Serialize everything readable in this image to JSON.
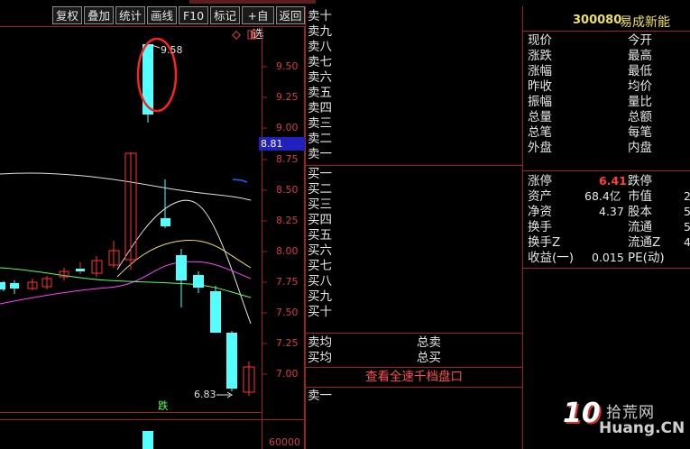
{
  "toolbar": {
    "buttons": [
      "复权",
      "叠加",
      "统计",
      "画线",
      "F10",
      "标记",
      "+自选",
      "返回"
    ]
  },
  "chart": {
    "price_ticks": [
      "9.50",
      "9.25",
      "9.00",
      "8.75",
      "8.50",
      "8.25",
      "8.00",
      "7.75",
      "7.50",
      "7.25",
      "7.00"
    ],
    "current_price_tag": "8.81",
    "high_annotation": "9.58",
    "low_annotation": "6.83",
    "volume_tick": "60000",
    "limit_down_marker": "跌"
  },
  "stock": {
    "code": "300080",
    "name": "易成新能"
  },
  "order_book": {
    "sell_levels": [
      "卖十",
      "卖九",
      "卖八",
      "卖七",
      "卖六",
      "卖五",
      "卖四",
      "卖三",
      "卖二",
      "卖一"
    ],
    "buy_levels": [
      "买一",
      "买二",
      "买三",
      "买四",
      "买五",
      "买六",
      "买七",
      "买八",
      "买九",
      "买十"
    ],
    "sell_avg_label": "卖均",
    "buy_avg_label": "买均",
    "total_sell_label": "总卖",
    "total_buy_label": "总买",
    "full_depth_link": "查看全速千档盘口",
    "bottom_sell_label": "卖一"
  },
  "quote": {
    "rows": [
      {
        "l": "现价",
        "r": "今开"
      },
      {
        "l": "涨跌",
        "r": "最高"
      },
      {
        "l": "涨幅",
        "r": "最低"
      },
      {
        "l": "昨收",
        "r": "均价"
      },
      {
        "l": "振幅",
        "r": "量比"
      },
      {
        "l": "总量",
        "r": "总额"
      },
      {
        "l": "总笔",
        "r": "每笔"
      },
      {
        "l": "外盘",
        "r": "内盘"
      }
    ],
    "limit_up_label": "涨停",
    "limit_up_value": "6.41",
    "limit_down_label": "跌停",
    "assets_label": "资产",
    "assets_value": "68.4亿",
    "market_value_label": "市值",
    "market_value_partial": "2",
    "net_assets_label": "净资",
    "net_assets_value": "4.37",
    "share_capital_label": "股本",
    "share_capital_partial": "5",
    "turnover_label": "换手",
    "float_label": "流通",
    "float_partial": "5",
    "turnover_z_label": "换手Z",
    "float_z_label": "流通Z",
    "float_z_partial": "4",
    "eps_label": "收益(一)",
    "eps_value": "0.015",
    "pe_label": "PE(动)"
  },
  "watermark": {
    "text1": "拾荒网",
    "text2": "Huang.CN",
    "badge": "10"
  },
  "colors": {
    "up_red": "#ff3232",
    "down_cyan": "#54ffff",
    "ma_white": "#e0e0e0",
    "ma_yellow": "#f0e060",
    "ma_magenta": "#ff40ff",
    "ma_green": "#60ff60",
    "ring_red": "#ff2020",
    "price_tag_bg": "#2020c0"
  }
}
